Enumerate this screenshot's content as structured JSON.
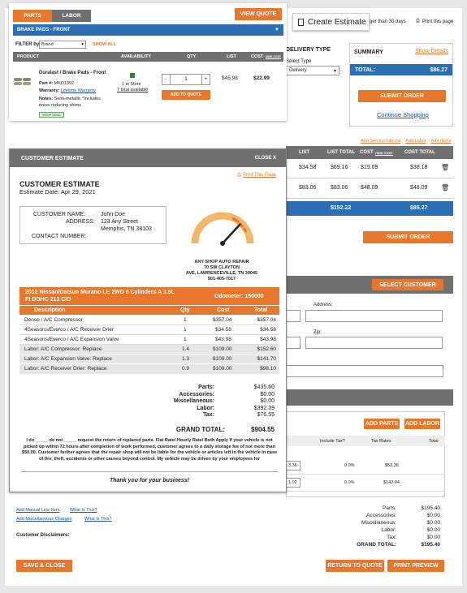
{
  "cart": {
    "tabs": [
      "PARTS",
      "LABOR"
    ],
    "view_quote": "VIEW QUOTE",
    "category": "BRAKE PADS - FRONT",
    "filter_label": "FILTER by",
    "filter_value": "Brand",
    "show_all": "SHOW ALL",
    "headers": {
      "product": "PRODUCT",
      "availability": "AVAILABILITY",
      "qty": "QTY",
      "list": "LIST",
      "cost": "COST",
      "hide_cost": "HIDE COST"
    },
    "item": {
      "title": "Duralast / Brake Pads - Front",
      "part_label": "Part #:",
      "part_num": "MKD1392",
      "warranty_label": "Warranty:",
      "warranty": "Lifetime Warranty",
      "notes_label": "Notes:",
      "notes": "Semi-metallic *Includes noise-reducing shims",
      "badge": "SHOP DEAL",
      "stock": "1 in Store",
      "total_avail": "7 total available",
      "qty": "1",
      "minus": "-",
      "plus": "+",
      "add_to_quote": "ADD TO QUOTE",
      "list": "$45.98",
      "cost": "$22.99"
    }
  },
  "create_estimate": "Create Estimate",
  "right_top": {
    "days": "ger than 30 days",
    "print": "Print this page"
  },
  "delivery": {
    "title": "DELIVERY TYPE",
    "label": "Select Type",
    "value": "Delivery"
  },
  "summary": {
    "title": "SUMMARY",
    "show_details": "Show Details",
    "total_label": "TOTAL:",
    "total": "$86.27",
    "submit": "SUBMIT ORDER",
    "continue": "Continue Shopping"
  },
  "bg_table": {
    "links": [
      "Add Service Interval",
      "Add Labor",
      "Add Items"
    ],
    "headers": [
      "LIST",
      "LIST TOTAL",
      "COST",
      "HIDE COST",
      "COST TOTAL"
    ],
    "rows": [
      [
        "$34.58",
        "$69.16",
        "$19.09",
        "$38.18"
      ],
      [
        "$83.06",
        "$83.06",
        "$48.09",
        "$48.09"
      ]
    ],
    "totals": [
      "$152.22",
      "$86.27"
    ],
    "submit": "SUBMIT ORDER"
  },
  "bg_mid": {
    "select_customer": "SELECT CUSTOMER",
    "address": "Address:",
    "zip": "Zip:",
    "add_parts": "ADD PARTS",
    "add_labor": "ADD LABOR",
    "headers": [
      "Include Tax?",
      "Tax Rates",
      "Total"
    ],
    "rows": [
      [
        "3.36",
        "0.0%",
        "$53.36"
      ],
      [
        "1.02",
        "0.0%",
        "$142.04"
      ]
    ]
  },
  "bg_bottom": {
    "add_manual": "Add Manual Line Item",
    "add_misc": "Add Miscellaneous Charges",
    "what": "What Is This?",
    "disclaimers": "Customer Disclaimers:",
    "totals": [
      [
        "Parts:",
        "$195.40"
      ],
      [
        "Accessories:",
        "$0.00"
      ],
      [
        "Miscellaneous:",
        "$0.00"
      ],
      [
        "Labor:",
        "$0.00"
      ],
      [
        "Tax:",
        "$0.00"
      ],
      [
        "GRAND TOTAL:",
        "$195.40"
      ]
    ],
    "save_close": "SAVE & CLOSE",
    "return_quote": "RETURN TO QUOTE",
    "print_preview": "PRINT PREVIEW"
  },
  "modal": {
    "title": "CUSTOMER ESTIMATE",
    "close": "CLOSE X",
    "print": "Print This Page",
    "heading": "CUSTOMER ESTIMATE",
    "date": "Estimate Date: Apr 29, 2021",
    "cust_name_label": "CUSTOMER NAME:",
    "cust_name": "John Doe",
    "address_label": "ADDRESS:",
    "address1": "123 Any Street",
    "address2": "Memphis, TN 38103",
    "contact_label": "CONTACT NUMBER:",
    "shop": [
      "ANY SHOP AUTO REPAIR",
      "70 SW CLAYTON",
      "AVE, LAWRENCEVILLE, TN 30045",
      "501-405-7017"
    ],
    "vehicle": "2012 Nissan/Datsun Murano LE 2WD 6 Cylinders A 3.5L FI DOHC 213 CID",
    "odometer": "Odometer: 150000",
    "headers": [
      "Description",
      "Qty",
      "Cost",
      "Total"
    ],
    "rows": [
      [
        "Denso / A/C Compressor",
        "1",
        "$357.04",
        "$357.04"
      ],
      [
        "4Seasons/Everco / A/C Receiver Drier",
        "1",
        "$34.58",
        "$34.58"
      ],
      [
        "4Seasons/Everco / A/C Expansion Valve",
        "1",
        "$43.98",
        "$43.98"
      ],
      [
        "Labor: A/C Compressor: Replace",
        "1.4",
        "$109.00",
        "$152.60"
      ],
      [
        "Labor: A/C Expansion Valve: Replace",
        "1.3",
        "$109.00",
        "$141.70"
      ],
      [
        "Labor: A/C Receiver Drier: Replace",
        "0.9",
        "$109.00",
        "$98.10"
      ]
    ],
    "totals": [
      [
        "Parts:",
        "$435.60"
      ],
      [
        "Accessories:",
        "$0.00"
      ],
      [
        "Miscellaneous:",
        "$0.00"
      ],
      [
        "Labor:",
        "$392.39"
      ],
      [
        "Tax:",
        "$76.55"
      ]
    ],
    "grand_label": "GRAND TOTAL:",
    "grand": "$904.55",
    "disclaimer": "I do _____ do not _____ request the return of replaced parts. Flat Rate/ Hourly Rate/ Both Apply If your vehicle is not picked up within 72 hours after completion of work performed, customer agrees to a daily storage fee of not more than $50.00. Customer further agrees that the repair shop will not be liable for the vehicle or articles left in the vehicle in case of fire, theft, accidents or other causes beyond control. My vehicle may be driven by your employees for",
    "thanks": "Thank you for your business!"
  },
  "colors": {
    "orange": "#e8762b",
    "blue": "#2c6eb4",
    "gray": "#707070"
  }
}
